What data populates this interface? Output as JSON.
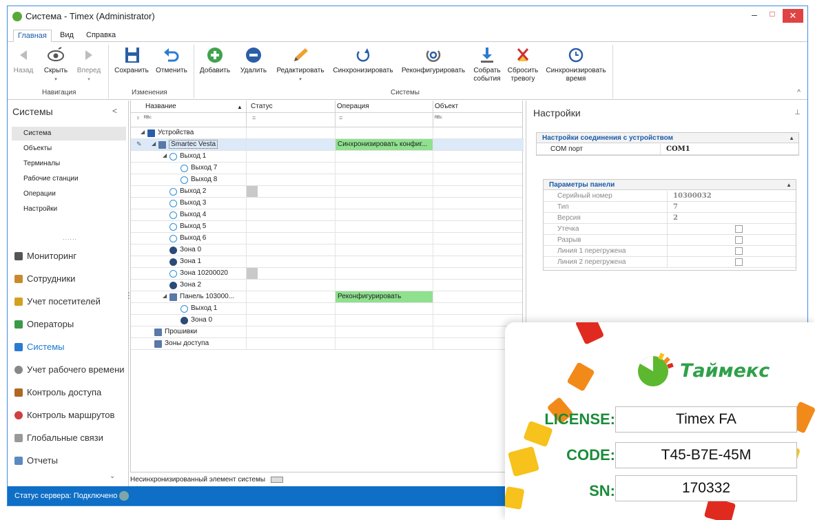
{
  "window": {
    "title": "Система - Timex (Administrator)",
    "min": "–",
    "max": "□",
    "close": "✕"
  },
  "menu_tabs": [
    "Главная",
    "Вид",
    "Справка"
  ],
  "ribbon": {
    "nav_group": "Навигация",
    "changes_group": "Изменения",
    "systems_group": "Системы",
    "back": "Назад",
    "hide": "Скрыть",
    "forward": "Вперед",
    "save": "Сохранить",
    "cancel": "Отменить",
    "add": "Добавить",
    "delete": "Удалить",
    "edit": "Редактировать",
    "sync": "Синхронизировать",
    "reconfigure": "Реконфигурировать",
    "collect_events_1": "Собрать",
    "collect_events_2": "события",
    "reset_alarm_1": "Сбросить",
    "reset_alarm_2": "тревогу",
    "sync_time_1": "Синхронизировать",
    "sync_time_2": "время",
    "collapse": "^",
    "hide_arrow": "▾",
    "forward_arrow": "▾",
    "edit_arrow": "▾"
  },
  "left_panel": {
    "title": "Системы",
    "collapse": "<",
    "items": [
      "Система",
      "Объекты",
      "Терминалы",
      "Рабочие станции",
      "Операции",
      "Настройки"
    ],
    "grip": "......",
    "nav": [
      "Мониторинг",
      "Сотрудники",
      "Учет посетителей",
      "Операторы",
      "Системы",
      "Учет рабочего времени",
      "Контроль доступа",
      "Контроль маршрутов",
      "Глобальные связи",
      "Отчеты"
    ],
    "vgrip": "⋮",
    "more": "⌄"
  },
  "grid": {
    "headers": [
      "Название",
      "Статус",
      "Операция",
      "Объект"
    ],
    "sort_arrow": "▲",
    "filter_name": "ᴿᴮᶜ",
    "filter_eq": "=",
    "filter_pin": "♀",
    "rows": [
      {
        "name": "Устройства",
        "operation": ""
      },
      {
        "name": "Smartec Vesta",
        "operation": "Синхронизировать конфиг..."
      },
      {
        "name": "Выход 1",
        "operation": ""
      },
      {
        "name": "Выход 7",
        "operation": ""
      },
      {
        "name": "Выход 8",
        "operation": ""
      },
      {
        "name": "Выход 2",
        "operation": ""
      },
      {
        "name": "Выход 3",
        "operation": ""
      },
      {
        "name": "Выход 4",
        "operation": ""
      },
      {
        "name": "Выход 5",
        "operation": ""
      },
      {
        "name": "Выход 6",
        "operation": ""
      },
      {
        "name": "Зона 0",
        "operation": ""
      },
      {
        "name": "Зона 1",
        "operation": ""
      },
      {
        "name": "Зона 10200020",
        "operation": ""
      },
      {
        "name": "Зона 2",
        "operation": ""
      },
      {
        "name": "Панель 103000...",
        "operation": "Реконфигурировать"
      },
      {
        "name": "Выход 1",
        "operation": ""
      },
      {
        "name": "Зона 0",
        "operation": ""
      },
      {
        "name": "Прошивки",
        "operation": ""
      },
      {
        "name": "Зоны доступа",
        "operation": ""
      }
    ],
    "legend": "Несинхронизированный элемент системы"
  },
  "settings": {
    "title": "Настройки",
    "pin": "⊥",
    "connection_header": "Настройки соединения с устройством",
    "com_label": "COM порт",
    "com_value": "COM1",
    "panel_header": "Параметры панели",
    "collapse": "▲",
    "params": [
      {
        "label": "Серийный номер",
        "value": "10300032"
      },
      {
        "label": "Тип",
        "value": "7"
      },
      {
        "label": "Версия",
        "value": "2"
      },
      {
        "label": "Утечка",
        "value": ""
      },
      {
        "label": "Разрыв",
        "value": ""
      },
      {
        "label": "Линия 1 перегружена",
        "value": ""
      },
      {
        "label": "Линия 2 перегружена",
        "value": ""
      }
    ]
  },
  "status": {
    "text": "Статус сервера: Подключено"
  },
  "license": {
    "brand": "Таймекс",
    "license_label": "LICENSE:",
    "license_value": "Timex FA",
    "code_label": "CODE:",
    "code_value": "T45-B7E-45M",
    "sn_label": "SN:",
    "sn_value": "170332"
  },
  "colors": {
    "accent": "#0f6fc6",
    "brand_green": "#2fa04a",
    "op_green": "#8fe08f"
  }
}
